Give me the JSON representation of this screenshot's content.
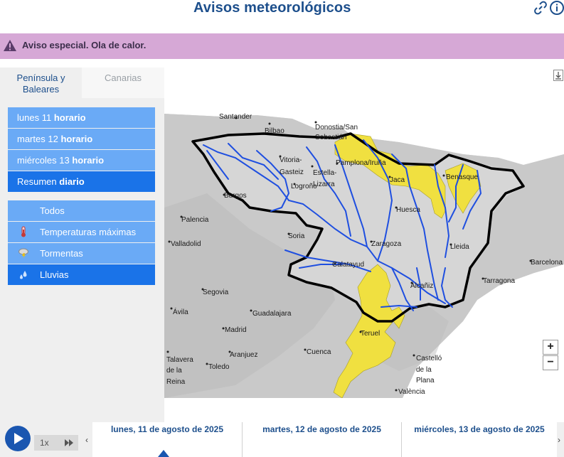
{
  "header": {
    "title": "Avisos meteorológicos",
    "link_icon": "link-icon",
    "info_icon": "info-icon"
  },
  "alert": {
    "icon": "warning-icon",
    "text": "Aviso especial. Ola de calor."
  },
  "tabs": [
    {
      "label": "Península y Baleares",
      "active": true
    },
    {
      "label": "Canarias",
      "active": false
    }
  ],
  "days_menu": [
    {
      "day": "lunes 11",
      "mode": "horario",
      "active": false
    },
    {
      "day": "martes 12",
      "mode": "horario",
      "active": false
    },
    {
      "day": "miércoles 13",
      "mode": "horario",
      "active": false
    },
    {
      "day": "Resumen",
      "mode": "diario",
      "active": true
    }
  ],
  "layers": [
    {
      "label": "Todos",
      "icon": "",
      "active": false
    },
    {
      "label": "Temperaturas máximas",
      "icon": "thermometer-icon",
      "active": false
    },
    {
      "label": "Tormentas",
      "icon": "storm-icon",
      "active": false
    },
    {
      "label": "Lluvias",
      "icon": "rain-icon",
      "active": true
    }
  ],
  "map": {
    "cities": [
      "Santander",
      "Bilbao",
      "Donostia/San",
      "Sebastián",
      "Vitoria-",
      "Gasteiz",
      "Pamplona/Iruña",
      "Estella-",
      "Lizarra",
      "Logroño",
      "Jaca",
      "Benasque",
      "Burgos",
      "Huesca",
      "Palencia",
      "Soria",
      "Zaragoza",
      "Lleida",
      "Valladolid",
      "Calatayud",
      "Barcelona",
      "Tarragona",
      "Alcañiz",
      "Segovia",
      "Ávila",
      "Guadalajara",
      "Madrid",
      "Teruel",
      "Cuenca",
      "Aranjuez",
      "Talavera",
      "de la",
      "Reina",
      "Toledo",
      "Castelló",
      "de la",
      "Plana",
      "València"
    ],
    "colors": {
      "land": "#c8c8c8",
      "warning_yellow": "#f0e040",
      "border": "#000000",
      "rivers": "#1f4fe0"
    },
    "zoom_in": "+",
    "zoom_out": "−",
    "logo": "aemet",
    "download_icon": "download-icon"
  },
  "timeline": {
    "play_icon": "play-icon",
    "speed": "1x",
    "ff_icon": "fast-forward-icon",
    "prev_icon": "chevron-left-icon",
    "next_icon": "chevron-right-icon",
    "days": [
      "lunes, 11 de agosto de 2025",
      "martes, 12 de agosto de 2025",
      "miércoles, 13 de agosto de 2025"
    ]
  }
}
